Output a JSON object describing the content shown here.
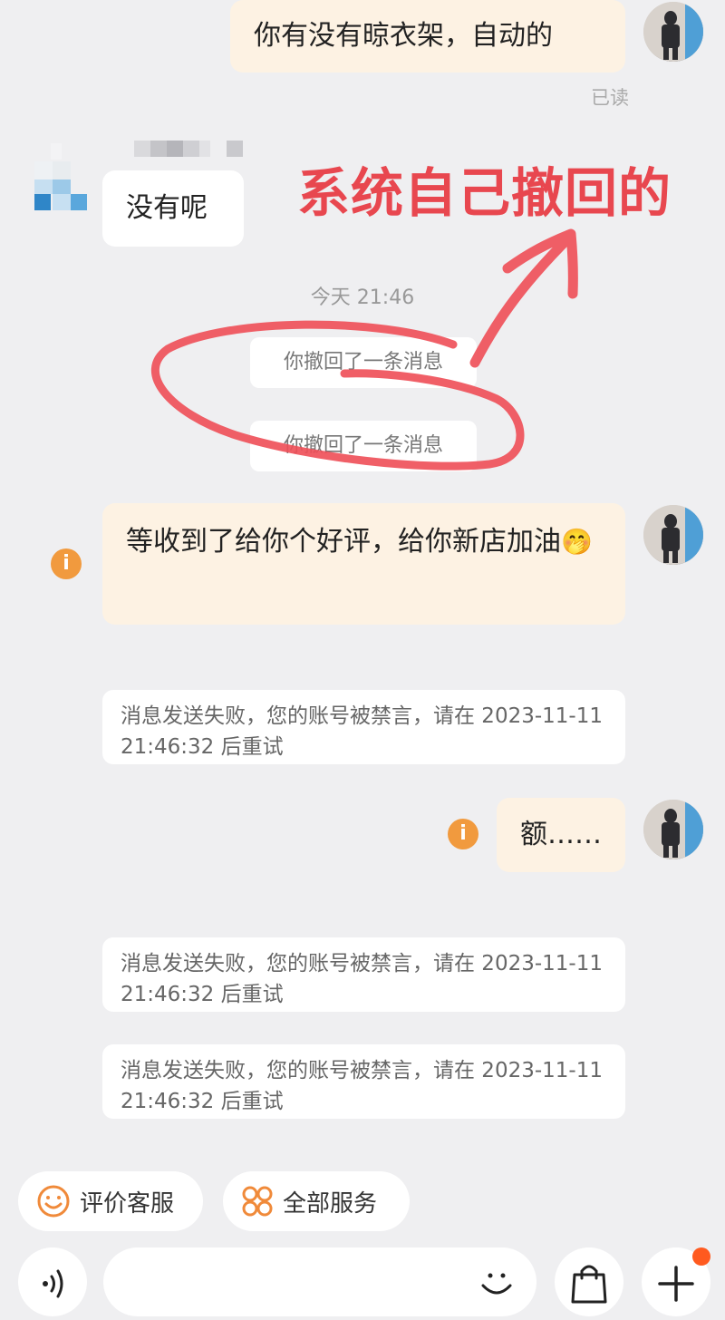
{
  "messages": {
    "m1_text": "你有没有晾衣架，自动的",
    "m1_status": "已读",
    "m2_text": "没有呢",
    "timestamp": "今天 21:46",
    "recall_1": "你撤回了一条消息",
    "recall_2": "你撤回了一条消息",
    "m3_text": "等收到了给你个好评，给你新店加油",
    "m3_emoji": "🤭",
    "notice_1": "消息发送失败，您的账号被禁言，请在 2023-11-11 21:46:32 后重试",
    "m4_text": "额……",
    "notice_2": "消息发送失败，您的账号被禁言，请在 2023-11-11 21:46:32 后重试",
    "notice_3": "消息发送失败，您的账号被禁言，请在 2023-11-11 21:46:32 后重试",
    "error_glyph": "i"
  },
  "annotation": {
    "text": "系统自己撤回的",
    "color": "#e8474f"
  },
  "quick_actions": {
    "rate_label": "评价客服",
    "services_label": "全部服务"
  },
  "composer": {
    "placeholder": "",
    "voice_icon": "voice-icon",
    "emoji_icon": "emoji-icon",
    "shop_icon": "shopping-bag-icon",
    "plus_icon": "plus-icon"
  },
  "colors": {
    "accent": "#f19a3e",
    "badge": "#ff5a1f",
    "my_bubble": "#fdf2e3",
    "background": "#efeff1"
  }
}
